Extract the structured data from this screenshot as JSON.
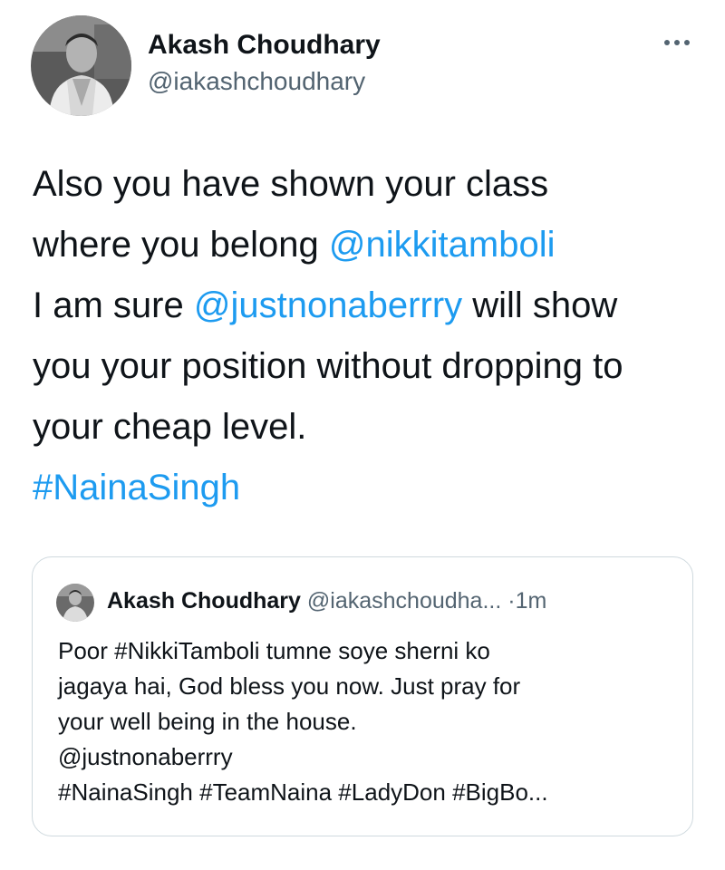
{
  "tweet": {
    "author_name": "Akash Choudhary",
    "author_handle": "@iakashchoudhary",
    "more_icon": "more-horizontal-icon",
    "lines": [
      {
        "text": "Also you have shown your class"
      },
      {
        "text": "where you belong ",
        "link": "@nikkitamboli"
      },
      {
        "text": "I am sure ",
        "link": "@justnonaberrry",
        "after": " will show"
      },
      {
        "text": "you your position without dropping to"
      },
      {
        "text": "your cheap level."
      },
      {
        "link_only": "#NainaSingh"
      }
    ]
  },
  "quoted_tweet": {
    "author_name": "Akash Choudhary",
    "author_handle": "@iakashchoudha...",
    "separator": "·",
    "time": "1m",
    "lines": [
      "Poor #NikkiTamboli tumne soye sherni ko",
      "jagaya hai, God bless you now. Just pray for",
      "your well being in the house.",
      "@justnonaberrry",
      "#NainaSingh #TeamNaina #LadyDon #BigBo..."
    ]
  },
  "colors": {
    "link": "#1d9bf0",
    "text": "#0f1419",
    "secondary": "#536471",
    "border": "#cfd9de"
  }
}
